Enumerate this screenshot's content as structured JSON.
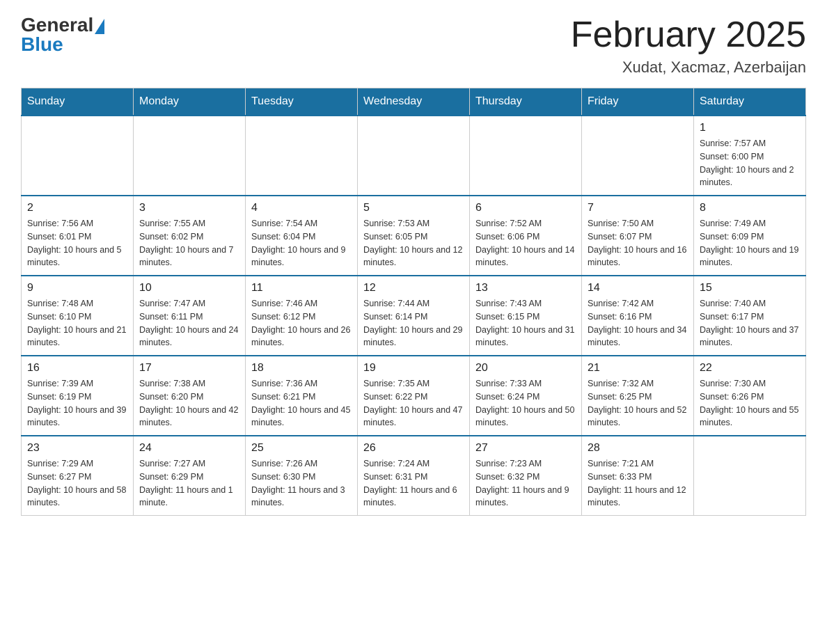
{
  "header": {
    "logo_general": "General",
    "logo_blue": "Blue",
    "title": "February 2025",
    "subtitle": "Xudat, Xacmaz, Azerbaijan"
  },
  "days_of_week": [
    "Sunday",
    "Monday",
    "Tuesday",
    "Wednesday",
    "Thursday",
    "Friday",
    "Saturday"
  ],
  "weeks": [
    [
      {
        "day": "",
        "info": ""
      },
      {
        "day": "",
        "info": ""
      },
      {
        "day": "",
        "info": ""
      },
      {
        "day": "",
        "info": ""
      },
      {
        "day": "",
        "info": ""
      },
      {
        "day": "",
        "info": ""
      },
      {
        "day": "1",
        "info": "Sunrise: 7:57 AM\nSunset: 6:00 PM\nDaylight: 10 hours and 2 minutes."
      }
    ],
    [
      {
        "day": "2",
        "info": "Sunrise: 7:56 AM\nSunset: 6:01 PM\nDaylight: 10 hours and 5 minutes."
      },
      {
        "day": "3",
        "info": "Sunrise: 7:55 AM\nSunset: 6:02 PM\nDaylight: 10 hours and 7 minutes."
      },
      {
        "day": "4",
        "info": "Sunrise: 7:54 AM\nSunset: 6:04 PM\nDaylight: 10 hours and 9 minutes."
      },
      {
        "day": "5",
        "info": "Sunrise: 7:53 AM\nSunset: 6:05 PM\nDaylight: 10 hours and 12 minutes."
      },
      {
        "day": "6",
        "info": "Sunrise: 7:52 AM\nSunset: 6:06 PM\nDaylight: 10 hours and 14 minutes."
      },
      {
        "day": "7",
        "info": "Sunrise: 7:50 AM\nSunset: 6:07 PM\nDaylight: 10 hours and 16 minutes."
      },
      {
        "day": "8",
        "info": "Sunrise: 7:49 AM\nSunset: 6:09 PM\nDaylight: 10 hours and 19 minutes."
      }
    ],
    [
      {
        "day": "9",
        "info": "Sunrise: 7:48 AM\nSunset: 6:10 PM\nDaylight: 10 hours and 21 minutes."
      },
      {
        "day": "10",
        "info": "Sunrise: 7:47 AM\nSunset: 6:11 PM\nDaylight: 10 hours and 24 minutes."
      },
      {
        "day": "11",
        "info": "Sunrise: 7:46 AM\nSunset: 6:12 PM\nDaylight: 10 hours and 26 minutes."
      },
      {
        "day": "12",
        "info": "Sunrise: 7:44 AM\nSunset: 6:14 PM\nDaylight: 10 hours and 29 minutes."
      },
      {
        "day": "13",
        "info": "Sunrise: 7:43 AM\nSunset: 6:15 PM\nDaylight: 10 hours and 31 minutes."
      },
      {
        "day": "14",
        "info": "Sunrise: 7:42 AM\nSunset: 6:16 PM\nDaylight: 10 hours and 34 minutes."
      },
      {
        "day": "15",
        "info": "Sunrise: 7:40 AM\nSunset: 6:17 PM\nDaylight: 10 hours and 37 minutes."
      }
    ],
    [
      {
        "day": "16",
        "info": "Sunrise: 7:39 AM\nSunset: 6:19 PM\nDaylight: 10 hours and 39 minutes."
      },
      {
        "day": "17",
        "info": "Sunrise: 7:38 AM\nSunset: 6:20 PM\nDaylight: 10 hours and 42 minutes."
      },
      {
        "day": "18",
        "info": "Sunrise: 7:36 AM\nSunset: 6:21 PM\nDaylight: 10 hours and 45 minutes."
      },
      {
        "day": "19",
        "info": "Sunrise: 7:35 AM\nSunset: 6:22 PM\nDaylight: 10 hours and 47 minutes."
      },
      {
        "day": "20",
        "info": "Sunrise: 7:33 AM\nSunset: 6:24 PM\nDaylight: 10 hours and 50 minutes."
      },
      {
        "day": "21",
        "info": "Sunrise: 7:32 AM\nSunset: 6:25 PM\nDaylight: 10 hours and 52 minutes."
      },
      {
        "day": "22",
        "info": "Sunrise: 7:30 AM\nSunset: 6:26 PM\nDaylight: 10 hours and 55 minutes."
      }
    ],
    [
      {
        "day": "23",
        "info": "Sunrise: 7:29 AM\nSunset: 6:27 PM\nDaylight: 10 hours and 58 minutes."
      },
      {
        "day": "24",
        "info": "Sunrise: 7:27 AM\nSunset: 6:29 PM\nDaylight: 11 hours and 1 minute."
      },
      {
        "day": "25",
        "info": "Sunrise: 7:26 AM\nSunset: 6:30 PM\nDaylight: 11 hours and 3 minutes."
      },
      {
        "day": "26",
        "info": "Sunrise: 7:24 AM\nSunset: 6:31 PM\nDaylight: 11 hours and 6 minutes."
      },
      {
        "day": "27",
        "info": "Sunrise: 7:23 AM\nSunset: 6:32 PM\nDaylight: 11 hours and 9 minutes."
      },
      {
        "day": "28",
        "info": "Sunrise: 7:21 AM\nSunset: 6:33 PM\nDaylight: 11 hours and 12 minutes."
      },
      {
        "day": "",
        "info": ""
      }
    ]
  ]
}
